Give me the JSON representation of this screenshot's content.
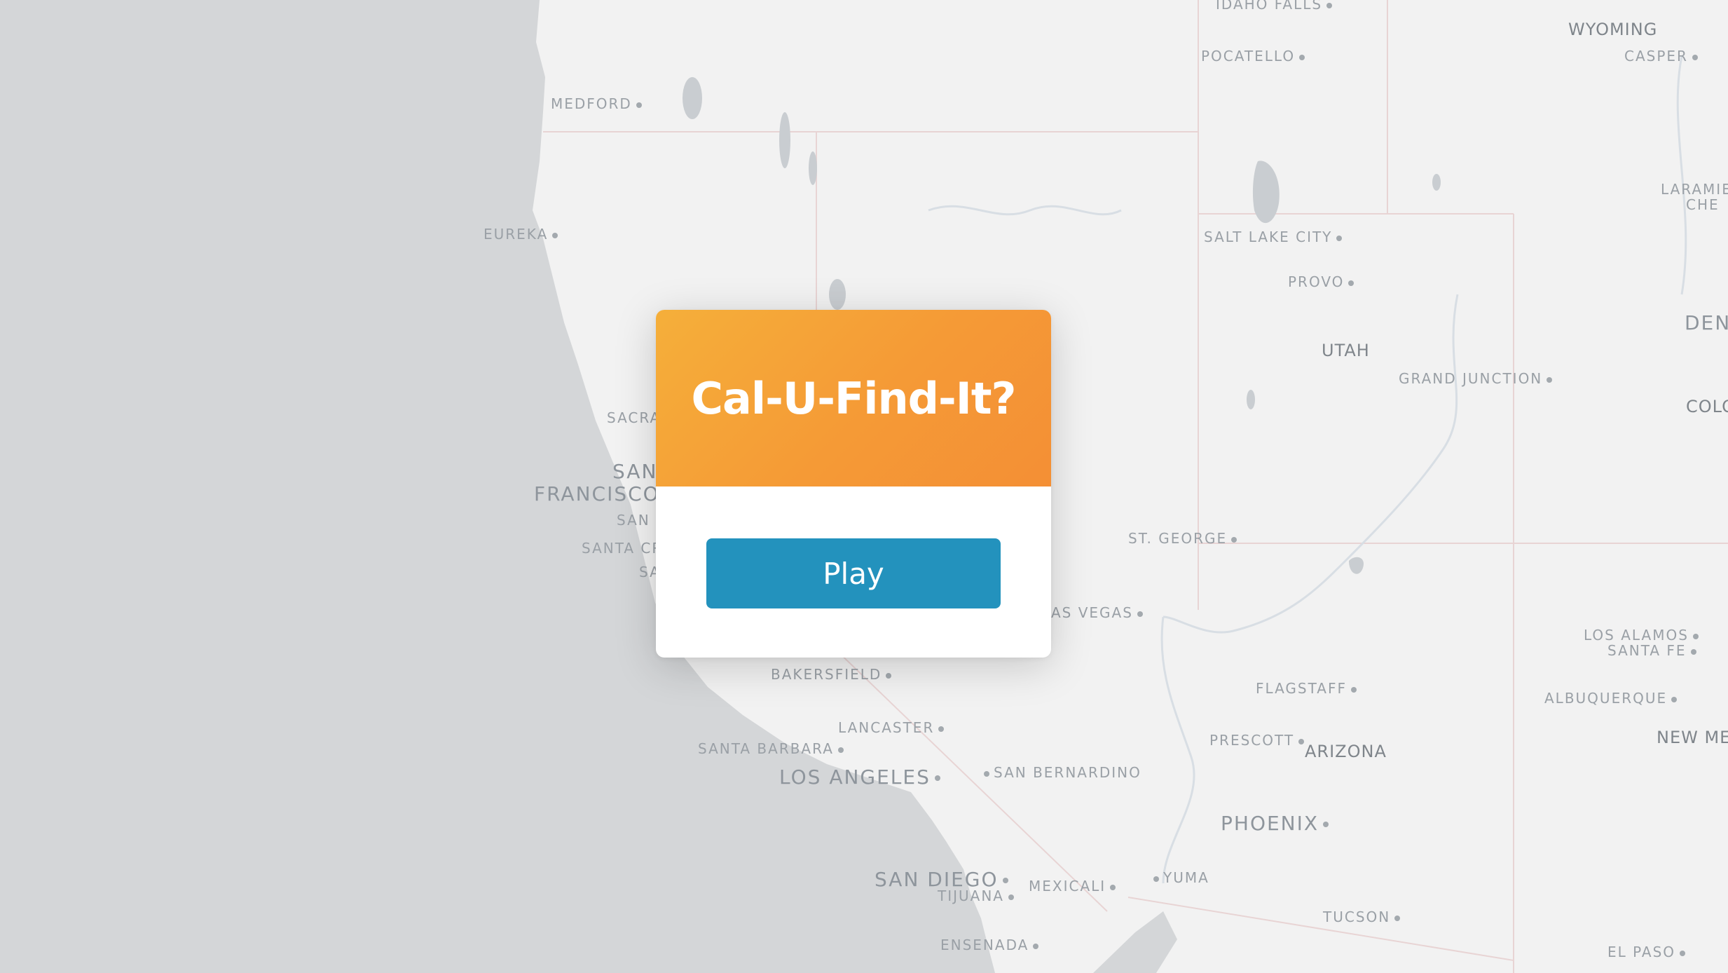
{
  "modal": {
    "title": "Cal-U-Find-It?",
    "play_label": "Play"
  },
  "map": {
    "colors": {
      "ocean": "#d4d6d8",
      "land": "#f2f2f2",
      "water": "#c9ccd0",
      "border": "#e6d3d3",
      "river": "#d6dde4"
    },
    "labels": {
      "idaho_falls": "IDAHO FALLS",
      "wyoming": "WYOMING",
      "pocatello": "POCATELLO",
      "casper": "CASPER",
      "medford": "MEDFORD",
      "laramie": "LARAMIE",
      "cheyenne": "CHE",
      "eureka": "EUREKA",
      "salt_lake_city": "SALT LAKE CITY",
      "provo": "PROVO",
      "denver": "DEN",
      "utah": "UTAH",
      "grand_junction": "GRAND JUNCTION",
      "colorado": "COLO",
      "sacramento": "SACRA",
      "san_francisco_1": "SAN",
      "san_francisco_2": "FRANCISCO",
      "san_jose": "SAN",
      "santa_cruz": "SANTA CR",
      "salinas": "SA",
      "st_george": "ST. GEORGE",
      "las_vegas": "AS VEGAS",
      "los_alamos": "LOS ALAMOS",
      "santa_fe": "SANTA FE",
      "bakersfield": "BAKERSFIELD",
      "flagstaff": "FLAGSTAFF",
      "albuquerque": "ALBUQUERQUE",
      "lancaster": "LANCASTER",
      "prescott": "PRESCOTT",
      "arizona": "ARIZONA",
      "new_mexico": "NEW MEX",
      "santa_barbara": "SANTA BARBARA",
      "los_angeles": "LOS ANGELES",
      "san_bernardino": "SAN BERNARDINO",
      "phoenix": "PHOENIX",
      "san_diego": "SAN DIEGO",
      "mexicali": "MEXICALI",
      "yuma": "YUMA",
      "tijuana": "TIJUANA",
      "tucson": "TUCSON",
      "ensenada": "ENSENADA",
      "el_paso": "EL PASO"
    }
  }
}
